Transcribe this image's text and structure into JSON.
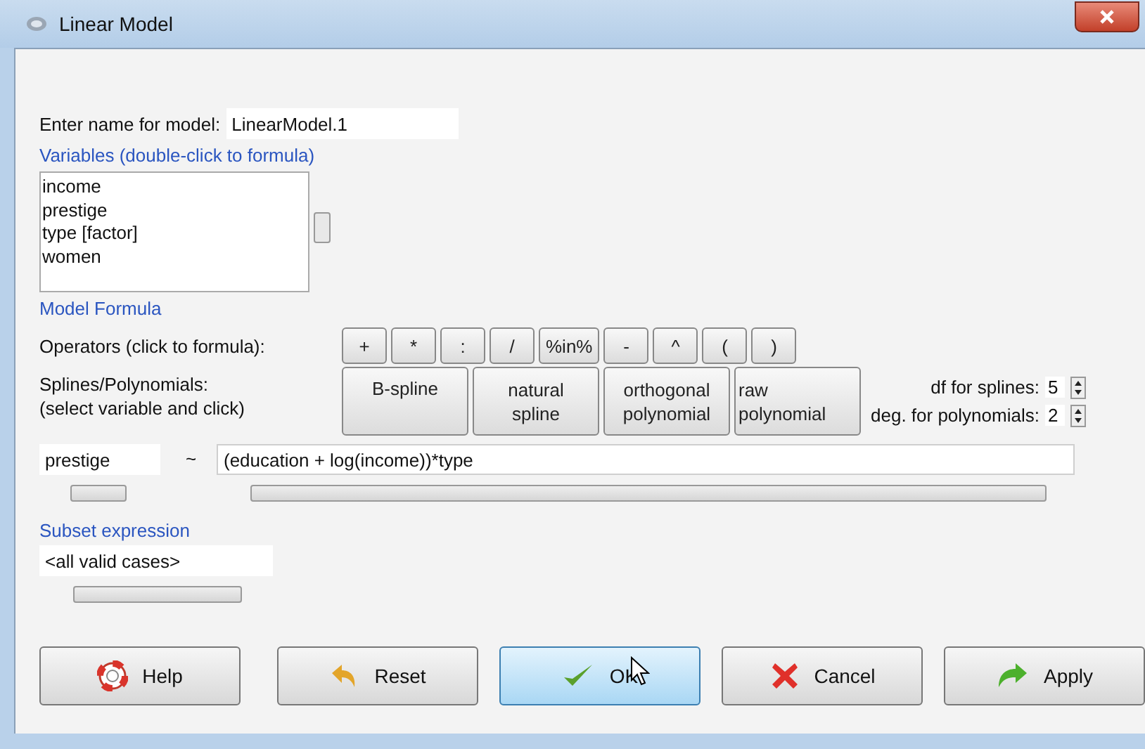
{
  "window": {
    "title": "Linear Model"
  },
  "model_name": {
    "label": "Enter name for model:",
    "value": "LinearModel.1"
  },
  "variables": {
    "label": "Variables (double-click to formula)",
    "items": [
      {
        "label": "income",
        "selected": false
      },
      {
        "label": "prestige",
        "selected": false
      },
      {
        "label": "type [factor]",
        "selected": false
      },
      {
        "label": "women",
        "selected": false
      }
    ]
  },
  "model_formula": {
    "label": "Model Formula"
  },
  "operators": {
    "label": "Operators (click to formula):",
    "buttons": [
      "+",
      "*",
      ":",
      "/",
      "%in%",
      "-",
      "^",
      "(",
      ")"
    ]
  },
  "splines": {
    "label_line1": "Splines/Polynomials:",
    "label_line2": "(select variable and click)",
    "buttons": [
      {
        "line1": "B-spline"
      },
      {
        "line1": "natural",
        "line2": "spline"
      },
      {
        "line1": "orthogonal",
        "line2": "polynomial"
      },
      {
        "line1": "raw",
        "line2": "polynomial"
      }
    ],
    "df_label": "df for splines:",
    "df_value": "5",
    "deg_label": "deg. for polynomials:",
    "deg_value": "2"
  },
  "formula": {
    "lhs": "prestige",
    "tilde": "~",
    "rhs": "(education + log(income))*type"
  },
  "subset": {
    "label": "Subset expression",
    "value": "<all valid cases>"
  },
  "buttons": [
    {
      "kind": "help",
      "label": "Help",
      "focused": false
    },
    {
      "kind": "reset",
      "label": "Reset",
      "focused": false
    },
    {
      "kind": "ok",
      "label": "OK",
      "focused": true
    },
    {
      "kind": "cancel",
      "label": "Cancel",
      "focused": false
    },
    {
      "kind": "apply",
      "label": "Apply",
      "focused": false
    }
  ]
}
